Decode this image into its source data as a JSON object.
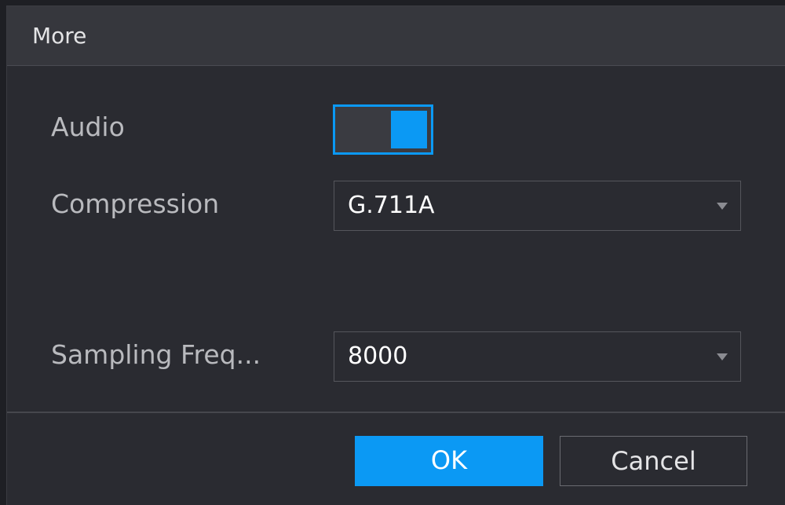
{
  "dialog": {
    "title": "More",
    "audio": {
      "label": "Audio",
      "enabled": true
    },
    "compression": {
      "label": "Compression",
      "value": "G.711A"
    },
    "sampling_frequency": {
      "label": "Sampling Freq...",
      "value": "8000"
    },
    "buttons": {
      "ok": "OK",
      "cancel": "Cancel"
    }
  },
  "colors": {
    "accent": "#0b99f4",
    "background": "#2a2b31",
    "titlebar": "#36373d"
  }
}
